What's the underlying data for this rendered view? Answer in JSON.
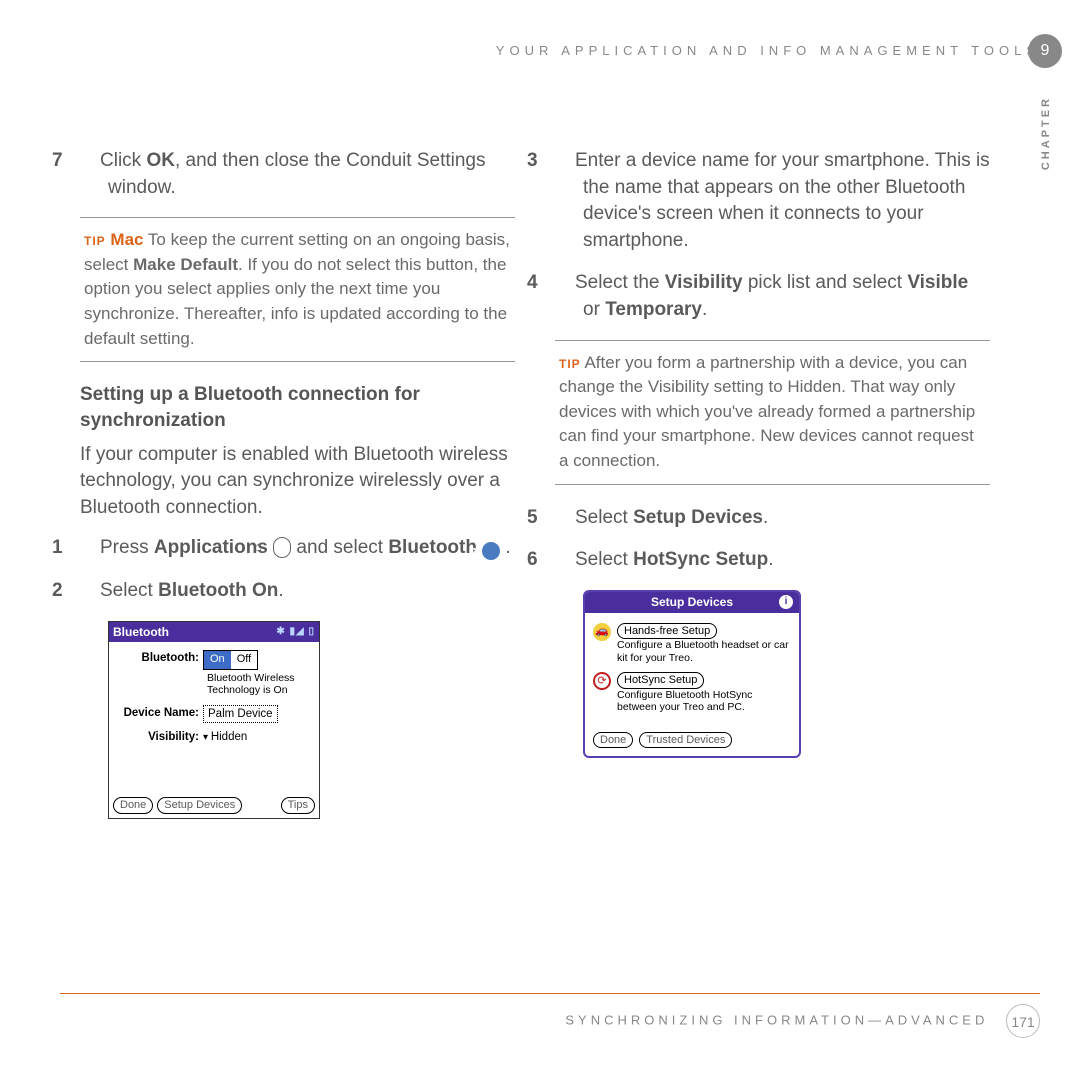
{
  "header": {
    "breadcrumb": "YOUR APPLICATION AND INFO MANAGEMENT TOOLS",
    "chapter_num": "9",
    "chapter_label": "CHAPTER"
  },
  "left": {
    "step7_num": "7",
    "step7_a": "Click ",
    "step7_b": "OK",
    "step7_c": ", and then close the Conduit Settings window.",
    "tip_label": "TIP",
    "mac_label": "Mac",
    "tip1_a": " To keep the current setting on an ongoing basis, select ",
    "tip1_b": "Make Default",
    "tip1_c": ". If you do not select this button, the option you select applies only the next time you synchronize. Thereafter, info is updated according to the default setting.",
    "subhead": "Setting up a Bluetooth connection for synchronization",
    "para": "If your computer is enabled with Bluetooth wireless technology, you can synchronize wirelessly over a Bluetooth connection.",
    "step1_num": "1",
    "step1_a": "Press ",
    "step1_b": "Applications",
    "step1_c": " and select ",
    "step1_d": "Bluetooth",
    "step1_e": " .",
    "step2_num": "2",
    "step2_a": "Select ",
    "step2_b": "Bluetooth On",
    "step2_c": "."
  },
  "palm1": {
    "title": "Bluetooth",
    "row1_label": "Bluetooth:",
    "on": "On",
    "off": "Off",
    "subtext": "Bluetooth Wireless Technology is On",
    "row2_label": "Device Name:",
    "device_name": "Palm Device",
    "row3_label": "Visibility:",
    "visibility": "Hidden",
    "btn_done": "Done",
    "btn_setup": "Setup Devices",
    "btn_tips": "Tips"
  },
  "right": {
    "step3_num": "3",
    "step3": "Enter a device name for your smartphone. This is the name that appears on the other Bluetooth device's screen when it connects to your smartphone.",
    "step4_num": "4",
    "step4_a": "Select the ",
    "step4_b": "Visibility",
    "step4_c": " pick list and select ",
    "step4_d": "Visible",
    "step4_e": " or ",
    "step4_f": "Temporary",
    "step4_g": ".",
    "tip_label": "TIP",
    "tip2": " After you form a partnership with a device, you can change the Visibility setting to Hidden. That way only devices with which you've already formed a partnership can find your smartphone. New devices cannot request a connection.",
    "step5_num": "5",
    "step5_a": "Select ",
    "step5_b": "Setup Devices",
    "step5_c": ".",
    "step6_num": "6",
    "step6_a": "Select ",
    "step6_b": "HotSync Setup",
    "step6_c": "."
  },
  "palm2": {
    "title": "Setup Devices",
    "info": "i",
    "btn_hands": "Hands-free Setup",
    "hands_desc": "Configure a Bluetooth headset or car kit for your Treo.",
    "btn_hotsync": "HotSync Setup",
    "hotsync_desc": "Configure Bluetooth HotSync between your Treo and PC.",
    "btn_done": "Done",
    "btn_trusted": "Trusted Devices"
  },
  "footer": {
    "text": "SYNCHRONIZING INFORMATION—ADVANCED",
    "page": "171"
  }
}
